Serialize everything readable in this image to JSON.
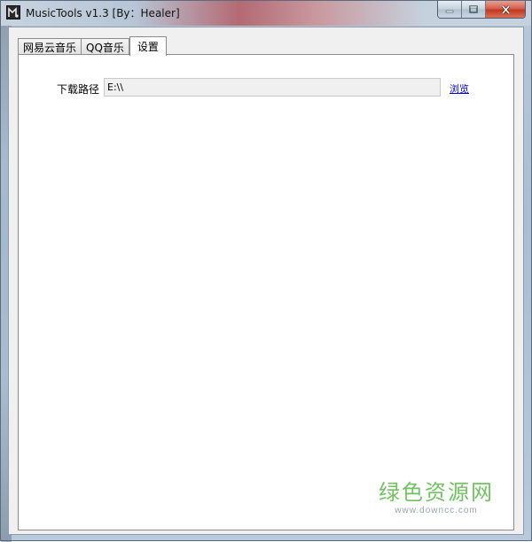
{
  "window": {
    "title": "MusicTools v1.3 [By：Healer]",
    "icon": "music-tools-app-icon"
  },
  "caption_buttons": {
    "minimize_icon": "minimize-icon",
    "maximize_icon": "maximize-icon",
    "close_icon": "close-icon"
  },
  "tabs": [
    {
      "label": "网易云音乐",
      "active": false
    },
    {
      "label": "QQ音乐",
      "active": false
    },
    {
      "label": "设置",
      "active": true
    }
  ],
  "settings": {
    "download_path_label": "下载路径",
    "download_path_value": "E:\\\\",
    "browse_label": "浏览"
  },
  "watermark": {
    "main": "绿色资源网",
    "url": "www.downcc.com"
  },
  "colors": {
    "link": "#0000cc",
    "watermark": "#58b845"
  }
}
